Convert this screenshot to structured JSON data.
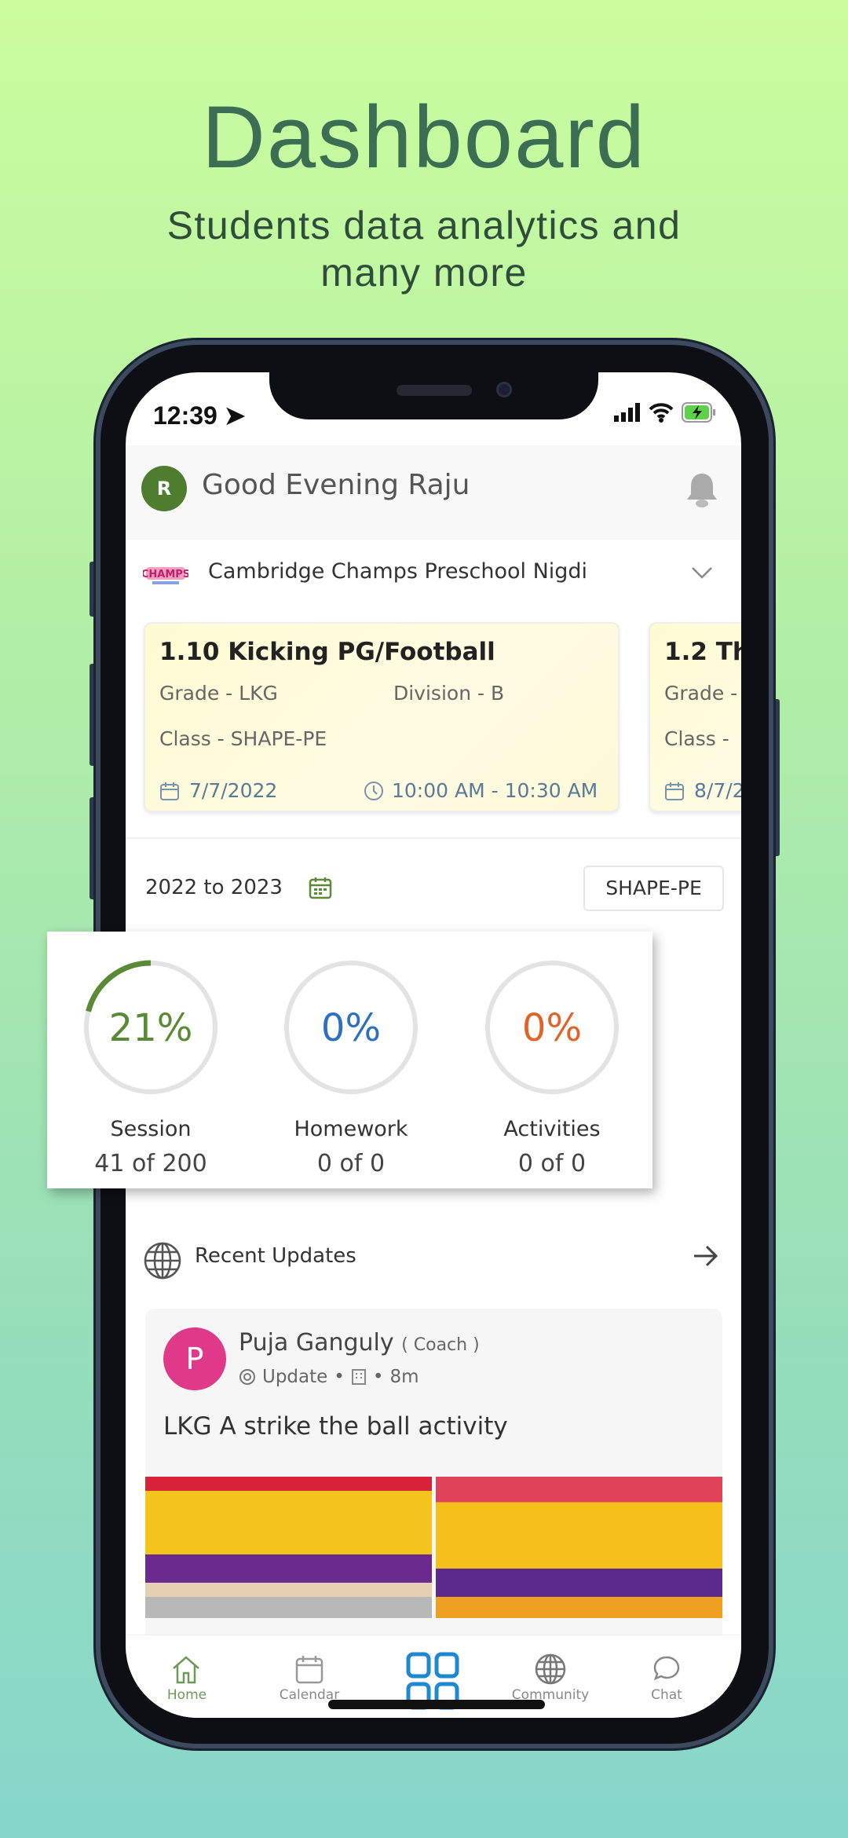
{
  "promo": {
    "title": "Dashboard",
    "subtitle_line1": "Students data analytics and",
    "subtitle_line2": "many more"
  },
  "status_bar": {
    "time": "12:39"
  },
  "header": {
    "avatar_initial": "R",
    "greeting": "Good Evening Raju"
  },
  "school": {
    "name": "Cambridge Champs Preschool Nigdi"
  },
  "sessions": [
    {
      "title": "1.10 Kicking PG/Football",
      "grade": "Grade - LKG",
      "division": "Division - B",
      "class": "Class - SHAPE-PE",
      "date": "7/7/2022",
      "time": "10:00 AM - 10:30 AM"
    },
    {
      "title": "1.2 Th",
      "grade": "Grade -",
      "class": "Class -",
      "date": "8/7/2"
    }
  ],
  "filter": {
    "year": "2022 to 2023",
    "class_button": "SHAPE-PE"
  },
  "stats": [
    {
      "label": "Session",
      "percent_text": "21%",
      "value": "41 of 200",
      "percent": 21,
      "color": "#5a8a35"
    },
    {
      "label": "Homework",
      "percent_text": "0%",
      "value": "0 of 0",
      "percent": 0,
      "color": "#2f6fc0"
    },
    {
      "label": "Activities",
      "percent_text": "0%",
      "value": "0 of 0",
      "percent": 0,
      "color": "#e0642a"
    }
  ],
  "recent": {
    "title": "Recent Updates"
  },
  "post": {
    "avatar_initial": "P",
    "author": "Puja Ganguly",
    "role": "( Coach )",
    "type": "Update",
    "time": "8m",
    "text": "LKG A strike the ball activity"
  },
  "nav": [
    {
      "label": "Home",
      "icon": "home-icon"
    },
    {
      "label": "Calendar",
      "icon": "calendar-icon"
    },
    {
      "label": "",
      "icon": "grid-icon"
    },
    {
      "label": "Community",
      "icon": "globe-icon"
    },
    {
      "label": "Chat",
      "icon": "chat-icon"
    }
  ]
}
